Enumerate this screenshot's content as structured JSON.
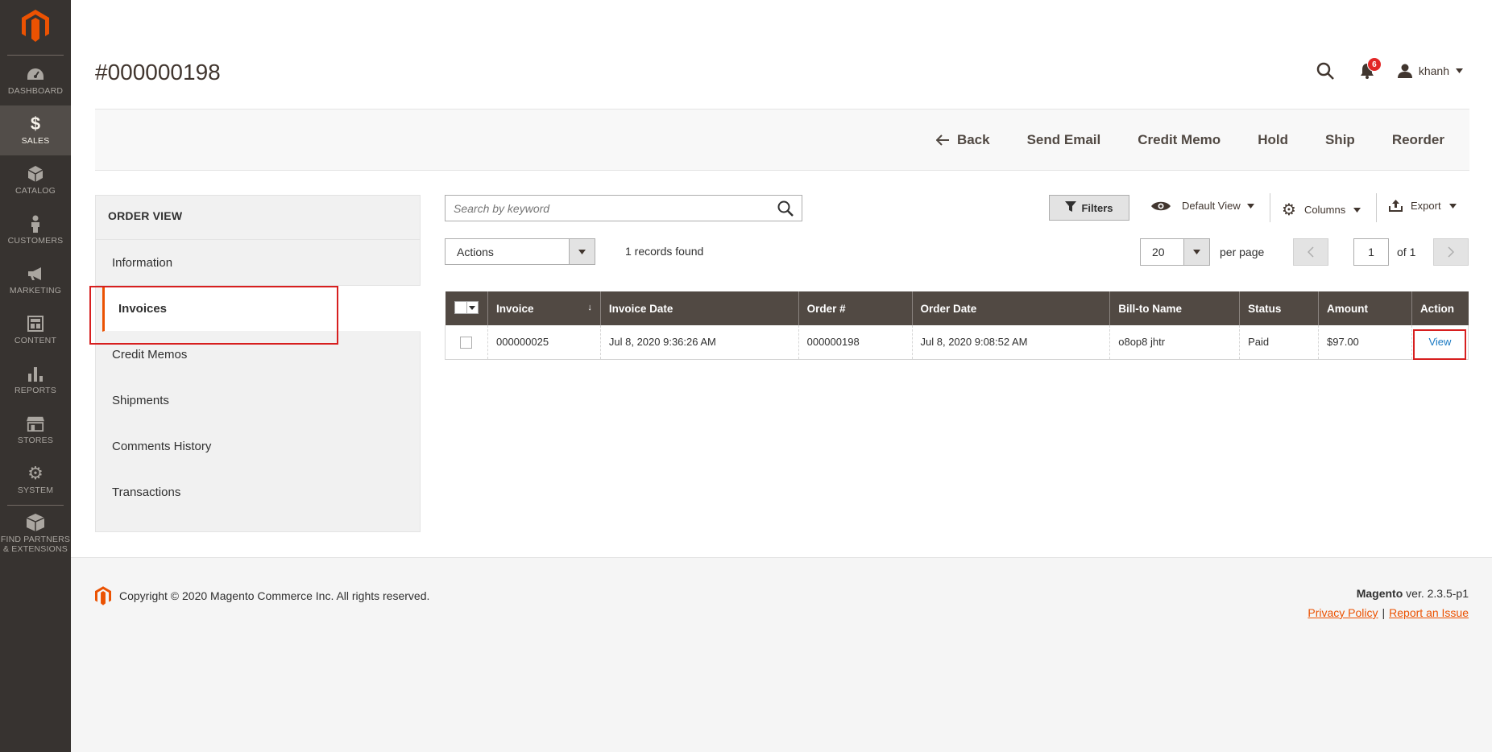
{
  "sidebar": {
    "items": [
      {
        "label": "DASHBOARD",
        "icon": "dashboard-icon"
      },
      {
        "label": "SALES",
        "icon": "dollar-icon",
        "active": true
      },
      {
        "label": "CATALOG",
        "icon": "cube-icon"
      },
      {
        "label": "CUSTOMERS",
        "icon": "person-icon"
      },
      {
        "label": "MARKETING",
        "icon": "megaphone-icon"
      },
      {
        "label": "CONTENT",
        "icon": "layout-icon"
      },
      {
        "label": "REPORTS",
        "icon": "bar-chart-icon"
      },
      {
        "label": "STORES",
        "icon": "store-icon"
      },
      {
        "label": "SYSTEM",
        "icon": "gear-icon"
      }
    ],
    "partners_label_1": "FIND PARTNERS",
    "partners_label_2": "& EXTENSIONS"
  },
  "header": {
    "title": "#000000198",
    "notifications_count": "6",
    "username": "khanh"
  },
  "action_bar": {
    "back": "Back",
    "send_email": "Send Email",
    "credit_memo": "Credit Memo",
    "hold": "Hold",
    "ship": "Ship",
    "reorder": "Reorder"
  },
  "order_tabs": {
    "title": "ORDER VIEW",
    "items": [
      "Information",
      "Invoices",
      "Credit Memos",
      "Shipments",
      "Comments History",
      "Transactions"
    ],
    "active": "Invoices"
  },
  "grid_toolbar": {
    "search_placeholder": "Search by keyword",
    "filters": "Filters",
    "default_view": "Default View",
    "columns": "Columns",
    "export": "Export",
    "actions": "Actions",
    "records_found": "1 records found",
    "per_page_value": "20",
    "per_page_label": "per page",
    "current_page": "1",
    "page_of": "of 1"
  },
  "grid": {
    "columns": [
      "Invoice",
      "Invoice Date",
      "Order #",
      "Order Date",
      "Bill-to Name",
      "Status",
      "Amount",
      "Action"
    ],
    "rows": [
      {
        "invoice": "000000025",
        "invoice_date": "Jul 8, 2020 9:36:26 AM",
        "order": "000000198",
        "order_date": "Jul 8, 2020 9:08:52 AM",
        "bill_to": "o8op8 jhtr",
        "status": "Paid",
        "amount": "$97.00",
        "action": "View"
      }
    ]
  },
  "footer": {
    "copyright": "Copyright © 2020 Magento Commerce Inc. All rights reserved.",
    "brand": "Magento",
    "version": " ver. 2.3.5-p1",
    "privacy": "Privacy Policy",
    "separator": "|",
    "report": "Report an Issue"
  },
  "colors": {
    "accent": "#eb5202",
    "sidebar_bg": "#373330",
    "grid_header_bg": "#514943",
    "link": "#1979c3",
    "highlight": "#d71f1f"
  }
}
